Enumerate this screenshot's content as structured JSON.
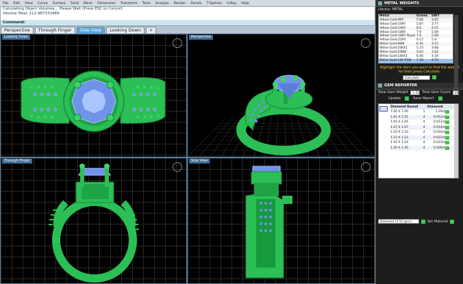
{
  "menu": [
    "File",
    "Edit",
    "View",
    "Curve",
    "Surface",
    "Solid",
    "Mesh",
    "Dimension",
    "Transform",
    "Tools",
    "Analyze",
    "Render",
    "Panels",
    "T-Splines",
    "V-Ray",
    "Help"
  ],
  "command": {
    "line1": "Calculating Object Volumes... Please Wait (Press ESC to Cancel)",
    "line2": "Volume Total: 112.987333489",
    "prompt": "Command:"
  },
  "view_tabs": [
    {
      "label": "Perspective",
      "active": false
    },
    {
      "label": "Through Finger",
      "active": false
    },
    {
      "label": "Side View",
      "active": true
    },
    {
      "label": "Looking Down",
      "active": false
    },
    {
      "label": "+",
      "active": false
    }
  ],
  "viewports": {
    "top_left": "Looking Down",
    "top_right": "Perspective",
    "bottom_left": "Through Finger",
    "bottom_right": "Side View"
  },
  "colors": {
    "metal": "#2bbf55",
    "metal_dark": "#168a38",
    "gem": "#6f93e8",
    "gem_light": "#aac4ff",
    "grid": "#2a2a2a"
  },
  "metal_panel": {
    "title": "METAL WEIGHTS",
    "library_label": "Library: METAL",
    "columns": [
      "Metal",
      "Grams",
      "DWT"
    ],
    "rows": [
      {
        "metal": "Yellow Gold:9KY",
        "grams": "5.68",
        "dwt": "3.65"
      },
      {
        "metal": "Yellow Gold:10KY",
        "grams": "5.87",
        "dwt": "3.77"
      },
      {
        "metal": "Yellow Gold:14KY",
        "grams": "6.6",
        "dwt": "4.25"
      },
      {
        "metal": "Yellow Gold:18KY",
        "grams": "7.9",
        "dwt": "5.09"
      },
      {
        "metal": "Yellow Gold:18KY Royal",
        "grams": "7.9",
        "dwt": "5.08"
      },
      {
        "metal": "Yellow Gold:22KY",
        "grams": "9.17",
        "dwt": "5.9"
      },
      {
        "metal": "White Gold:9KW",
        "grams": "6.45",
        "dwt": "4.15"
      },
      {
        "metal": "White Gold:10KX1",
        "grams": "5.73",
        "dwt": "3.68"
      },
      {
        "metal": "White Gold:10KW",
        "grams": "5.63",
        "dwt": "3.62"
      },
      {
        "metal": "White Gold:14KX1",
        "grams": "6.46",
        "dwt": "4.16"
      },
      {
        "metal": "White Gold:14K PSW",
        "grams": "7.39",
        "dwt": "4.75"
      }
    ],
    "selected_row": 10,
    "hint": "Highlight the item you want to find the weight for then press Calculate.",
    "calculate_label": "Calculate"
  },
  "gem_panel": {
    "title": "GEM REPORTER",
    "total_weight_label": "Total Gem Weight",
    "total_weight": "1.43",
    "total_count_label": "Total Gem Count",
    "total_count": "28",
    "update_label": "Update",
    "save_label": "Save Report",
    "columns": [
      "Diamond Round",
      "",
      "Diamond",
      ""
    ],
    "rows": [
      {
        "size": "7.00 X 7.00",
        "count": "1",
        "weight": "1.29ct"
      },
      {
        "size": "1.01 X 1.01",
        "count": "4",
        "weight": "0.012ct"
      },
      {
        "size": "1.04 X 1.04",
        "count": "4",
        "weight": "0.013ct"
      },
      {
        "size": "1.07 X 1.07",
        "count": "4",
        "weight": "0.014ct"
      },
      {
        "size": "1.10 X 1.10",
        "count": "4",
        "weight": "0.016ct"
      },
      {
        "size": "1.13 X 1.13",
        "count": "4",
        "weight": "0.022ct"
      },
      {
        "size": "1.16 X 1.16",
        "count": "4",
        "weight": "0.023ct"
      },
      {
        "size": "1.20 X 1.20",
        "count": "4",
        "weight": "0.026ct"
      }
    ],
    "material_value": "Diamond (3.52 g/cc)",
    "set_material_label": "Set Material"
  }
}
